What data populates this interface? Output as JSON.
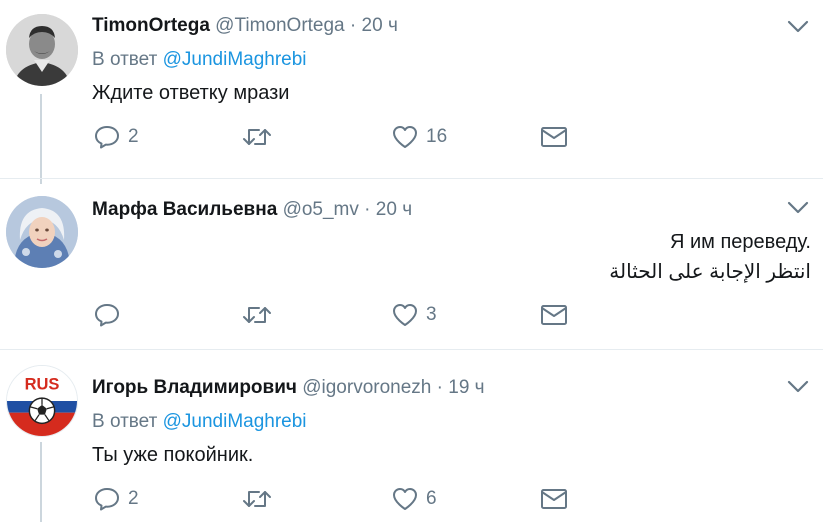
{
  "tweets": [
    {
      "name": "TimonOrtega",
      "handle": "@TimonOrtega",
      "separator": "·",
      "time": "20 ч",
      "reply_prefix": "В ответ",
      "reply_to": "@JundiMaghrebi",
      "text": "Ждите ответку мрази",
      "replies": "2",
      "retweets": "",
      "likes": "16",
      "avatar_icon": "portrait-avatar-icon"
    },
    {
      "name": "Марфа Васильевна",
      "handle": "@o5_mv",
      "separator": "·",
      "time": "20 ч",
      "text_line1": "Я им переведу.",
      "text_line2": "انتظر الإجابة على الحثالة",
      "replies": "",
      "retweets": "",
      "likes": "3",
      "avatar_icon": "woman-avatar-icon"
    },
    {
      "name": "Игорь Владимирович",
      "handle": "@igorvoronezh",
      "separator": "·",
      "time": "19 ч",
      "reply_prefix": "В ответ",
      "reply_to": "@JundiMaghrebi",
      "text": "Ты уже покойник.",
      "replies": "2",
      "retweets": "",
      "likes": "6",
      "avatar_icon": "rus-football-avatar-icon",
      "avatar_text": "RUS"
    }
  ],
  "colors": {
    "text": "#14171a",
    "secondary": "#657786",
    "link": "#1b95e0",
    "separator": "#e6ecf0",
    "thread_line": "#ccd6dd"
  }
}
